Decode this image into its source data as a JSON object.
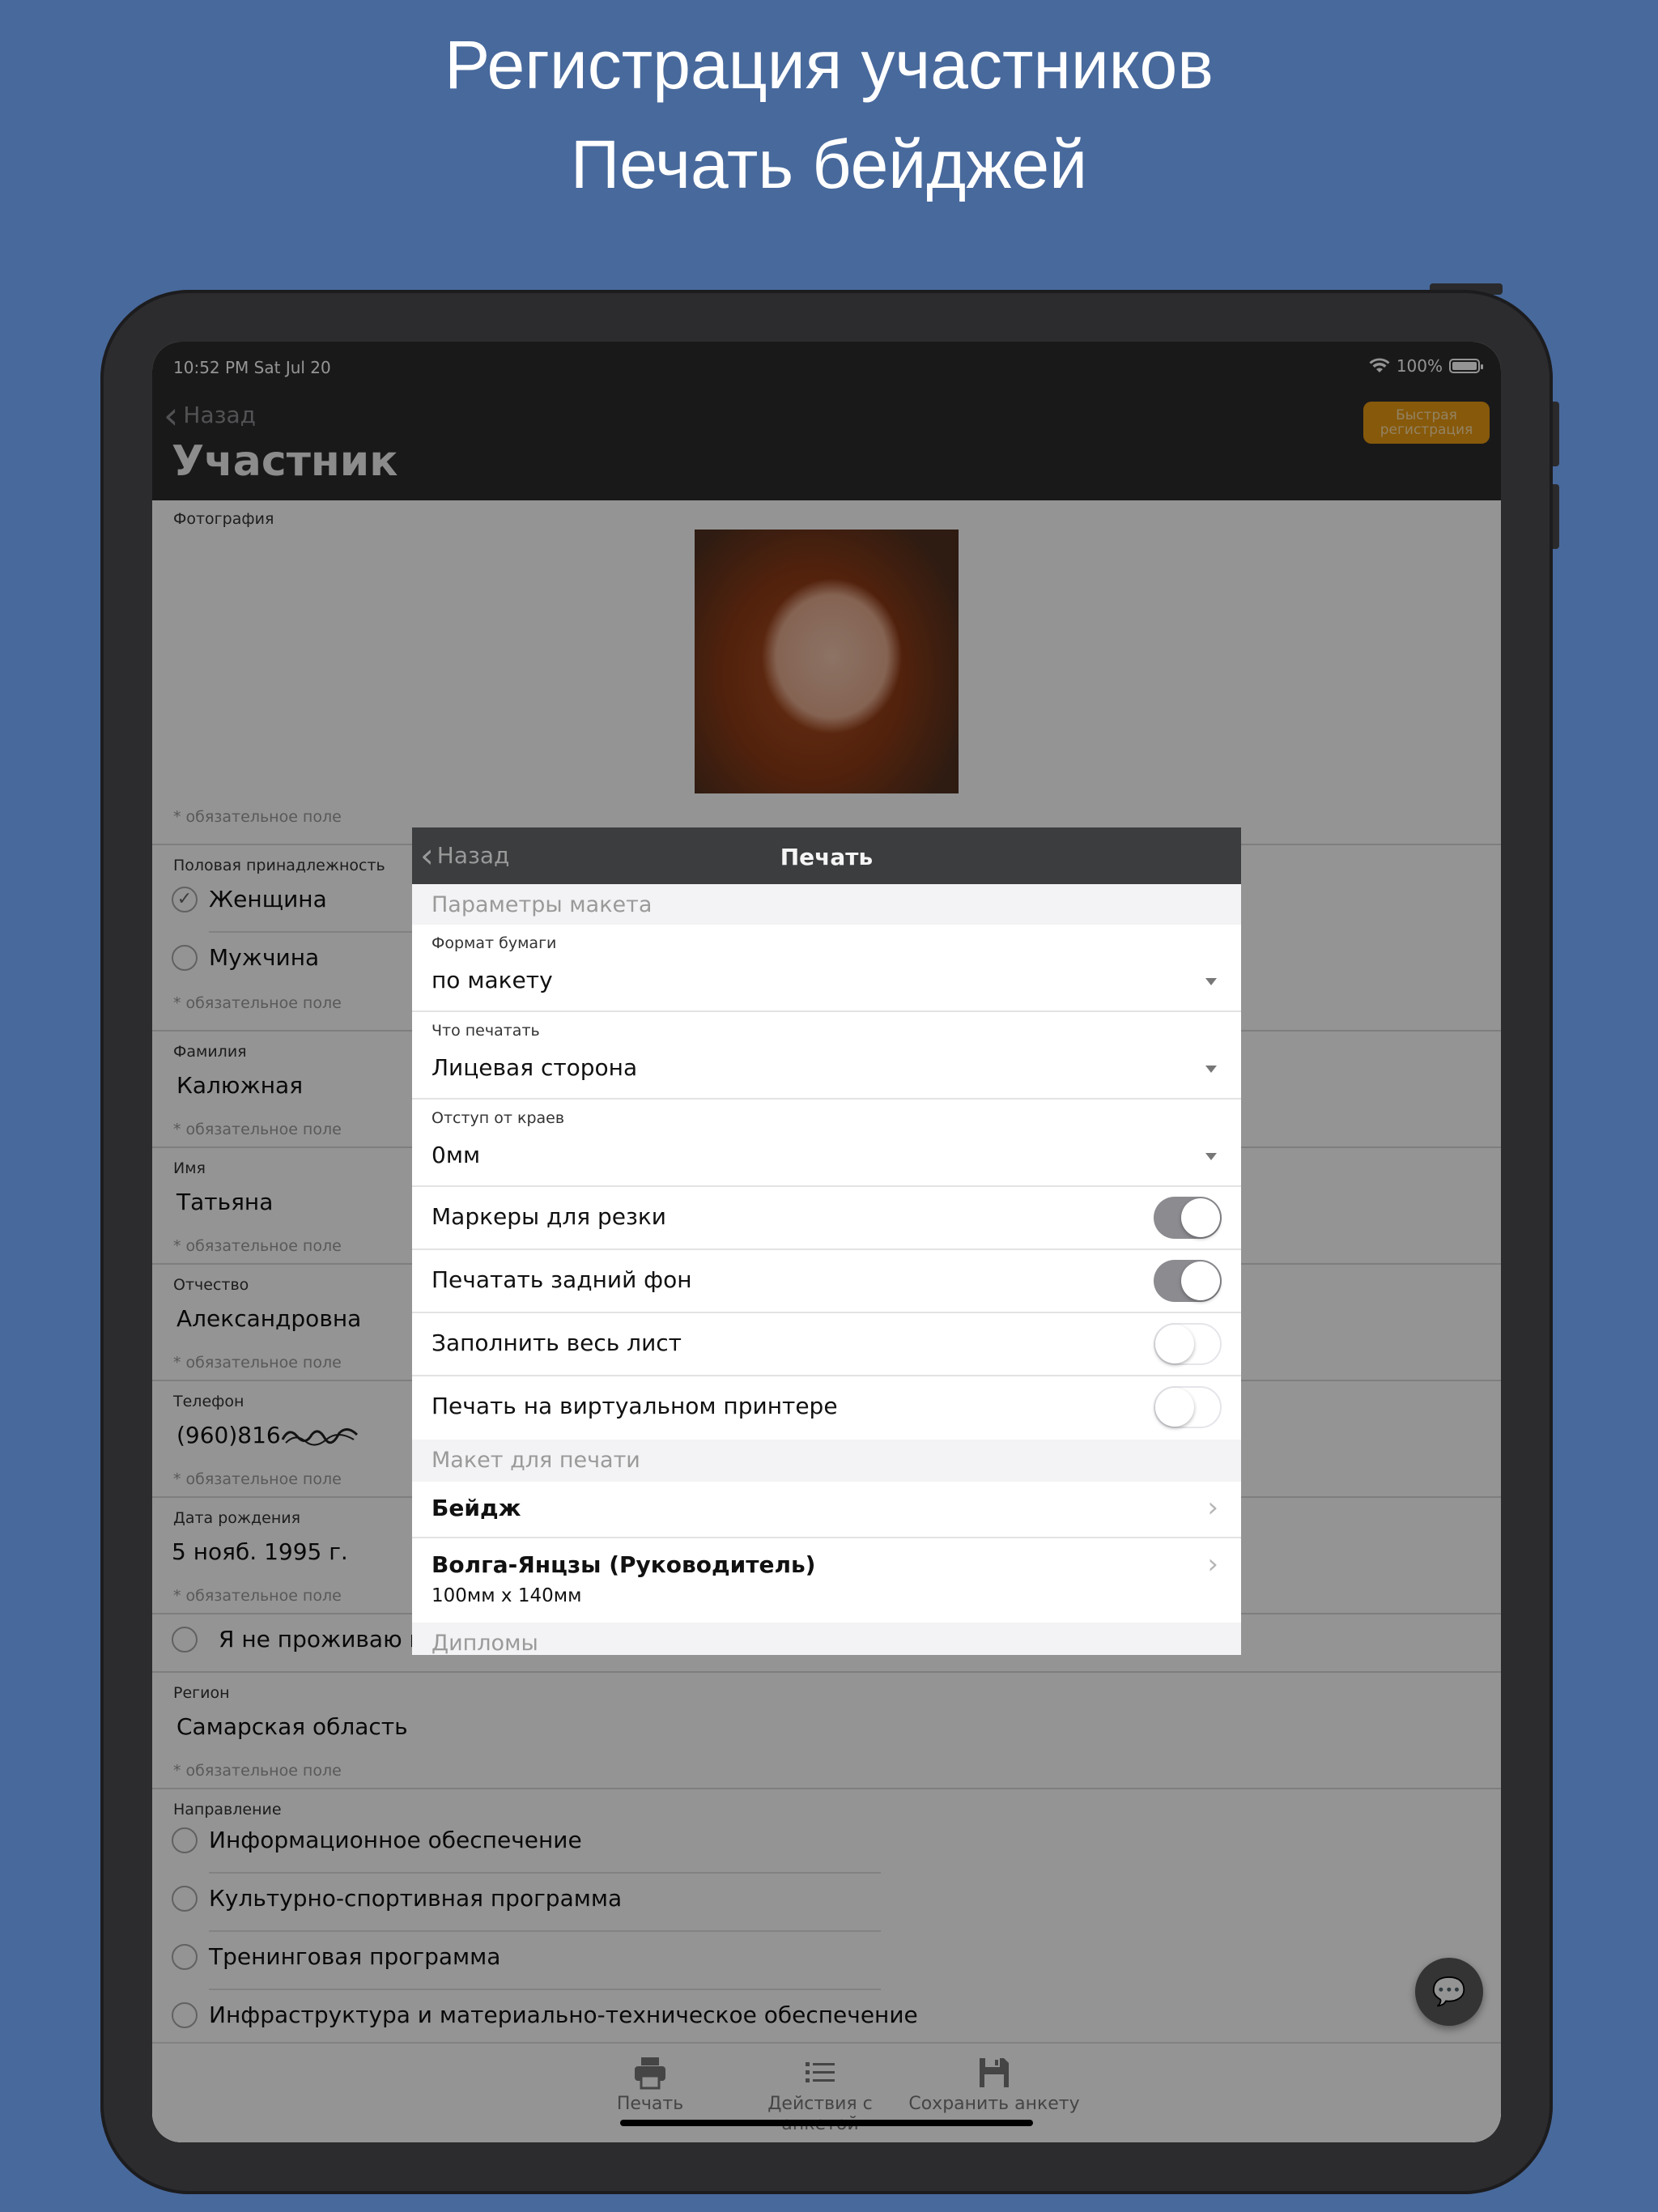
{
  "promo": {
    "line1": "Регистрация участников",
    "line2": "Печать бейджей"
  },
  "status_bar": {
    "time": "10:52 PM   Sat Jul 20",
    "battery": "100%",
    "wifi_icon": "wifi-icon"
  },
  "nav": {
    "back": "Назад",
    "quick_registration": "Быстрая регистрация",
    "title": "Участник"
  },
  "form": {
    "photo_label": "Фотография",
    "required": "* обязательное поле",
    "gender_label": "Половая принадлежность",
    "gender_options": [
      "Женщина",
      "Мужчина"
    ],
    "gender_selected": "Женщина",
    "surname_label": "Фамилия",
    "surname": "Калюжная",
    "name_label": "Имя",
    "name": "Татьяна",
    "patronymic_label": "Отчество",
    "patronymic": "Александровна",
    "phone_label": "Телефон",
    "phone": "(960)816",
    "birthdate_label": "Дата рождения",
    "birthdate": "5 нояб. 1995 г.",
    "not_living_checkbox": "Я не проживаю на",
    "region_label": "Регион",
    "region": "Самарская область",
    "direction_label": "Направление",
    "direction_options": [
      "Информационное обеспечение",
      "Культурно-спортивная программа",
      "Тренинговая программа",
      "Инфраструктура и материально-техническое обеспечение"
    ]
  },
  "modal": {
    "back": "Назад",
    "title": "Печать",
    "section_layout_params": "Параметры макета",
    "paper_format_label": "Формат бумаги",
    "paper_format": "по макету",
    "what_to_print_label": "Что печатать",
    "what_to_print": "Лицевая сторона",
    "margin_label": "Отступ от краев",
    "margin": "0мм",
    "toggles": [
      {
        "label": "Маркеры для резки",
        "on": true
      },
      {
        "label": "Печатать задний фон",
        "on": true
      },
      {
        "label": "Заполнить весь лист",
        "on": false
      },
      {
        "label": "Печать на виртуальном принтере",
        "on": false
      }
    ],
    "section_print_layout": "Макет для печати",
    "layout_badge": "Бейдж",
    "layout_template_title": "Волга-Янцзы (Руководитель)",
    "layout_template_size": "100мм x 140мм",
    "section_diplomas": "Дипломы"
  },
  "tabbar": {
    "print": "Печать",
    "actions": "Действия с анкетой",
    "save": "Сохранить анкету"
  },
  "colors": {
    "background": "#48699c",
    "accent": "#e89a12",
    "navbar": "#2c2c2e",
    "toggle_on": "#8b8b90"
  }
}
